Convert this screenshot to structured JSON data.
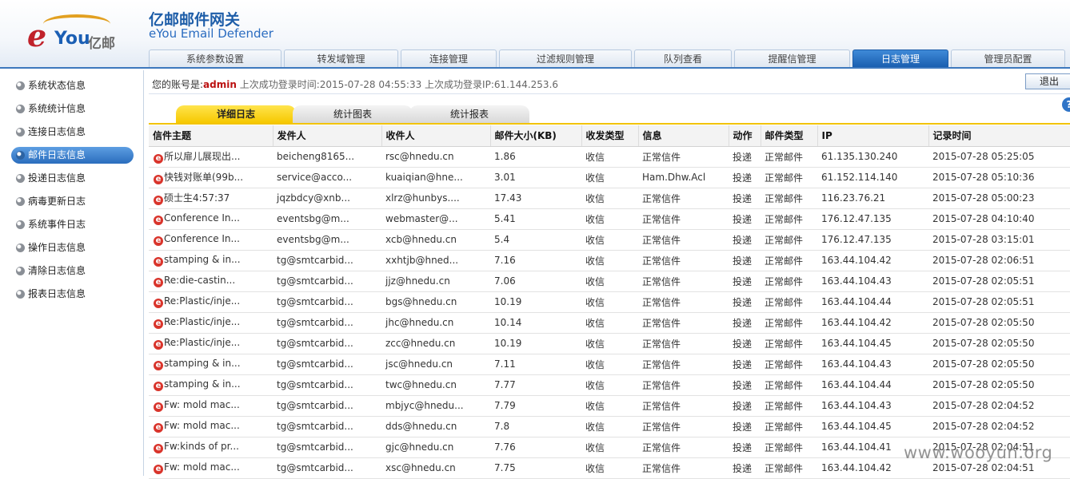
{
  "header": {
    "logo_text_e": "e",
    "logo_text_you": "You",
    "logo_text_cn": "亿邮",
    "title_cn": "亿邮邮件网关",
    "title_en": "eYou Email Defender"
  },
  "tabs": [
    {
      "label": "系统参数设置"
    },
    {
      "label": "转发域管理"
    },
    {
      "label": "连接管理"
    },
    {
      "label": "过滤规则管理"
    },
    {
      "label": "队列查看"
    },
    {
      "label": "提醒信管理"
    },
    {
      "label": "日志管理",
      "active": true
    },
    {
      "label": "管理员配置"
    }
  ],
  "sidebar": {
    "items": [
      {
        "label": "系统状态信息"
      },
      {
        "label": "系统统计信息"
      },
      {
        "label": "连接日志信息"
      },
      {
        "label": "邮件日志信息",
        "active": true
      },
      {
        "label": "投递日志信息"
      },
      {
        "label": "病毒更新日志"
      },
      {
        "label": "系统事件日志"
      },
      {
        "label": "操作日志信息"
      },
      {
        "label": "清除日志信息"
      },
      {
        "label": "报表日志信息"
      }
    ]
  },
  "info": {
    "account_label": "您的账号是:",
    "account": "admin",
    "last_login": "上次成功登录时间:2015-07-28 04:55:33 上次成功登录IP:61.144.253.6",
    "logout_label": "退出",
    "help_icon": "?"
  },
  "subtabs": [
    {
      "label": "详细日志",
      "active": true
    },
    {
      "label": "统计图表"
    },
    {
      "label": "统计报表"
    }
  ],
  "table": {
    "columns": [
      "信件主题",
      "发件人",
      "收件人",
      "邮件大小(KB)",
      "收发类型",
      "信息",
      "动作",
      "邮件类型",
      "IP",
      "记录时间"
    ],
    "rows": [
      [
        "所以扉儿展现出...",
        "beicheng8165...",
        "rsc@hnedu.cn",
        "1.86",
        "收信",
        "正常信件",
        "投递",
        "正常邮件",
        "61.135.130.240",
        "2015-07-28 05:25:05"
      ],
      [
        "快钱对账单(99b...",
        "service@acco...",
        "kuaiqian@hne...",
        "3.01",
        "收信",
        "Ham.Dhw.Acl",
        "投递",
        "正常邮件",
        "61.152.114.140",
        "2015-07-28 05:10:36"
      ],
      [
        "硕士生4:57:37",
        "jqzbdcy@xnb...",
        "xlrz@hunbys....",
        "17.43",
        "收信",
        "正常信件",
        "投递",
        "正常邮件",
        "116.23.76.21",
        "2015-07-28 05:00:23"
      ],
      [
        "Conference In...",
        "eventsbg@m...",
        "webmaster@...",
        "5.41",
        "收信",
        "正常信件",
        "投递",
        "正常邮件",
        "176.12.47.135",
        "2015-07-28 04:10:40"
      ],
      [
        "Conference In...",
        "eventsbg@m...",
        "xcb@hnedu.cn",
        "5.4",
        "收信",
        "正常信件",
        "投递",
        "正常邮件",
        "176.12.47.135",
        "2015-07-28 03:15:01"
      ],
      [
        "stamping & in...",
        "tg@smtcarbid...",
        "xxhtjb@hned...",
        "7.16",
        "收信",
        "正常信件",
        "投递",
        "正常邮件",
        "163.44.104.42",
        "2015-07-28 02:06:51"
      ],
      [
        "Re:die-castin...",
        "tg@smtcarbid...",
        "jjz@hnedu.cn",
        "7.06",
        "收信",
        "正常信件",
        "投递",
        "正常邮件",
        "163.44.104.43",
        "2015-07-28 02:05:51"
      ],
      [
        "Re:Plastic/inje...",
        "tg@smtcarbid...",
        "bgs@hnedu.cn",
        "10.19",
        "收信",
        "正常信件",
        "投递",
        "正常邮件",
        "163.44.104.44",
        "2015-07-28 02:05:51"
      ],
      [
        "Re:Plastic/inje...",
        "tg@smtcarbid...",
        "jhc@hnedu.cn",
        "10.14",
        "收信",
        "正常信件",
        "投递",
        "正常邮件",
        "163.44.104.42",
        "2015-07-28 02:05:50"
      ],
      [
        "Re:Plastic/inje...",
        "tg@smtcarbid...",
        "zcc@hnedu.cn",
        "10.19",
        "收信",
        "正常信件",
        "投递",
        "正常邮件",
        "163.44.104.45",
        "2015-07-28 02:05:50"
      ],
      [
        "stamping & in...",
        "tg@smtcarbid...",
        "jsc@hnedu.cn",
        "7.11",
        "收信",
        "正常信件",
        "投递",
        "正常邮件",
        "163.44.104.43",
        "2015-07-28 02:05:50"
      ],
      [
        "stamping & in...",
        "tg@smtcarbid...",
        "twc@hnedu.cn",
        "7.77",
        "收信",
        "正常信件",
        "投递",
        "正常邮件",
        "163.44.104.44",
        "2015-07-28 02:05:50"
      ],
      [
        "Fw: mold mac...",
        "tg@smtcarbid...",
        "mbjyc@hnedu...",
        "7.79",
        "收信",
        "正常信件",
        "投递",
        "正常邮件",
        "163.44.104.43",
        "2015-07-28 02:04:52"
      ],
      [
        "Fw: mold mac...",
        "tg@smtcarbid...",
        "dds@hnedu.cn",
        "7.8",
        "收信",
        "正常信件",
        "投递",
        "正常邮件",
        "163.44.104.45",
        "2015-07-28 02:04:52"
      ],
      [
        "Fw:kinds of pr...",
        "tg@smtcarbid...",
        "gjc@hnedu.cn",
        "7.76",
        "收信",
        "正常信件",
        "投递",
        "正常邮件",
        "163.44.104.41",
        "2015-07-28 02:04:51"
      ],
      [
        "Fw: mold mac...",
        "tg@smtcarbid...",
        "xsc@hnedu.cn",
        "7.75",
        "收信",
        "正常信件",
        "投递",
        "正常邮件",
        "163.44.104.42",
        "2015-07-28 02:04:51"
      ]
    ],
    "row_icon": "e"
  },
  "watermark": "www.wooyun.org",
  "colors": {
    "accent": "#2a6dbd",
    "tab_active": "#1a5fb0",
    "subtab_active": "#f6c800",
    "mail_icon": "#d9342b",
    "account": "#bb1111"
  }
}
